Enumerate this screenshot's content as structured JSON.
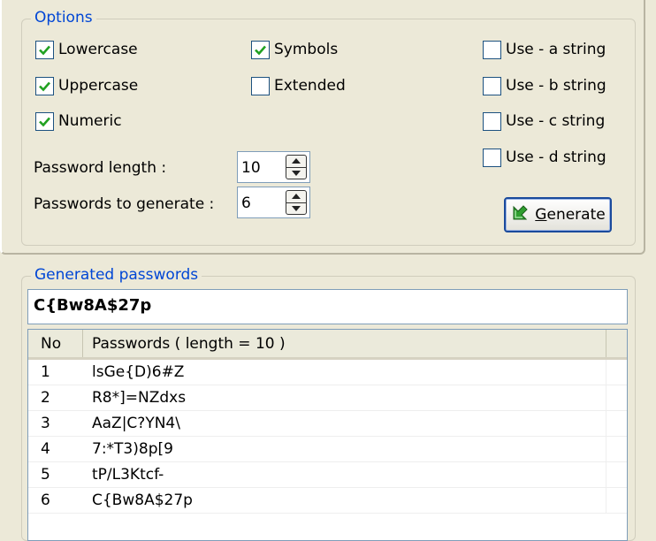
{
  "options": {
    "title": "Options",
    "checkboxes": [
      {
        "label": "Lowercase",
        "checked": true
      },
      {
        "label": "Uppercase",
        "checked": true
      },
      {
        "label": "Numeric",
        "checked": true
      },
      {
        "label": "Symbols",
        "checked": true
      },
      {
        "label": "Extended",
        "checked": false
      },
      {
        "label": "Use - a string",
        "checked": false
      },
      {
        "label": "Use - b string",
        "checked": false
      },
      {
        "label": "Use - c string",
        "checked": false
      },
      {
        "label": "Use - d string",
        "checked": false
      }
    ],
    "password_length_label": "Password length :",
    "password_length_value": "10",
    "passwords_to_generate_label": "Passwords to generate :",
    "passwords_to_generate_value": "6",
    "generate_label": "Generate"
  },
  "generated": {
    "title": "Generated passwords",
    "current": "C{Bw8A$27p",
    "columns": [
      "No",
      "Passwords ( length = 10 )"
    ],
    "rows": [
      {
        "no": "1",
        "password": "lsGe{D)6#Z"
      },
      {
        "no": "2",
        "password": "R8*]=NZdxs"
      },
      {
        "no": "3",
        "password": "AaZ|C?YN4\\"
      },
      {
        "no": "4",
        "password": "7:*T3)8p[9"
      },
      {
        "no": "5",
        "password": "tP/L3Ktcf-"
      },
      {
        "no": "6",
        "password": "C{Bw8A$27p"
      }
    ]
  },
  "colors": {
    "accent": "#0046d5",
    "check": "#21a121",
    "window": "#ece9d8"
  },
  "icons": {
    "check": "checkmark-icon",
    "spin_up": "spin-up-icon",
    "spin_down": "spin-down-icon",
    "generate": "green-arrow-icon"
  }
}
